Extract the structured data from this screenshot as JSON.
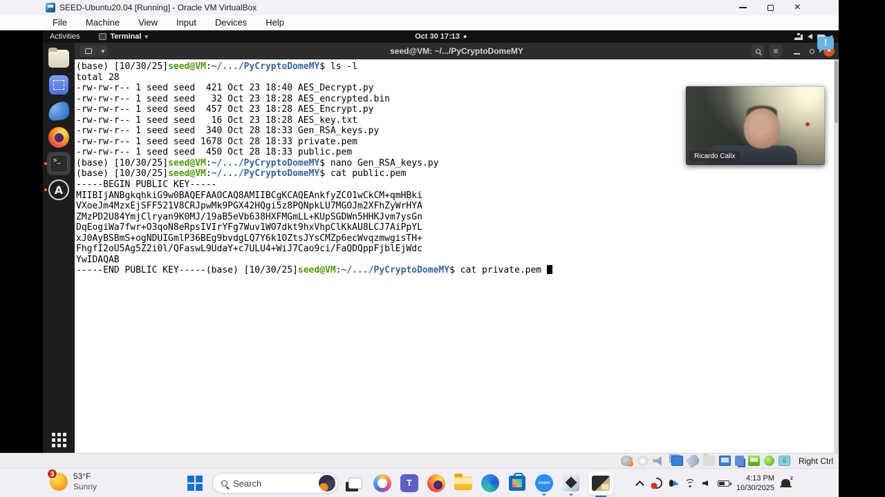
{
  "window": {
    "title": "SEED-Ubuntu20.04 [Running] - Oracle VM VirtualBox",
    "menus": [
      "File",
      "Machine",
      "View",
      "Input",
      "Devices",
      "Help"
    ]
  },
  "ubuntu_top_bar": {
    "activities": "Activities",
    "focused_app": "Terminal",
    "clock": "Oct 30 17:13"
  },
  "dock": {
    "items": [
      {
        "name": "files"
      },
      {
        "name": "screenshot-tool"
      },
      {
        "name": "wireshark"
      },
      {
        "name": "firefox"
      },
      {
        "name": "terminal",
        "running": true,
        "active": true
      },
      {
        "name": "anaconda-navigator",
        "running": true
      }
    ]
  },
  "terminal": {
    "title": "seed@VM: ~/.../PyCryptoDomeMY",
    "colors": {
      "prompt_user": "#4e9a06",
      "prompt_path": "#3465a4",
      "fg": "#000000",
      "bg": "#ffffff"
    },
    "lines": [
      {
        "seg": [
          {
            "t": "(base) [10/30/25]",
            "c": ""
          },
          {
            "t": "seed@VM",
            "c": "u"
          },
          {
            "t": ":",
            "c": ""
          },
          {
            "t": "~/.../PyCryptoDomeMY",
            "c": "p"
          },
          {
            "t": "$ ls -l",
            "c": ""
          }
        ]
      },
      {
        "seg": [
          {
            "t": "total 28",
            "c": ""
          }
        ]
      },
      {
        "seg": [
          {
            "t": "-rw-rw-r-- 1 seed seed  421 Oct 23 18:40 AES_Decrypt.py",
            "c": ""
          }
        ]
      },
      {
        "seg": [
          {
            "t": "-rw-rw-r-- 1 seed seed   32 Oct 23 18:28 AES_encrypted.bin",
            "c": ""
          }
        ]
      },
      {
        "seg": [
          {
            "t": "-rw-rw-r-- 1 seed seed  457 Oct 23 18:28 AES_Encrypt.py",
            "c": ""
          }
        ]
      },
      {
        "seg": [
          {
            "t": "-rw-rw-r-- 1 seed seed   16 Oct 23 18:28 AES_key.txt",
            "c": ""
          }
        ]
      },
      {
        "seg": [
          {
            "t": "-rw-rw-r-- 1 seed seed  340 Oct 28 18:33 Gen_RSA_keys.py",
            "c": ""
          }
        ]
      },
      {
        "seg": [
          {
            "t": "-rw-rw-r-- 1 seed seed 1678 Oct 28 18:33 private.pem",
            "c": ""
          }
        ]
      },
      {
        "seg": [
          {
            "t": "-rw-rw-r-- 1 seed seed  450 Oct 28 18:33 public.pem",
            "c": ""
          }
        ]
      },
      {
        "seg": [
          {
            "t": "(base) [10/30/25]",
            "c": ""
          },
          {
            "t": "seed@VM",
            "c": "u"
          },
          {
            "t": ":",
            "c": ""
          },
          {
            "t": "~/.../PyCryptoDomeMY",
            "c": "p"
          },
          {
            "t": "$ nano Gen_RSA_keys.py",
            "c": ""
          }
        ]
      },
      {
        "seg": [
          {
            "t": "(base) [10/30/25]",
            "c": ""
          },
          {
            "t": "seed@VM",
            "c": "u"
          },
          {
            "t": ":",
            "c": ""
          },
          {
            "t": "~/.../PyCryptoDomeMY",
            "c": "p"
          },
          {
            "t": "$ cat public.pem",
            "c": ""
          }
        ]
      },
      {
        "seg": [
          {
            "t": "-----BEGIN PUBLIC KEY-----",
            "c": ""
          }
        ]
      },
      {
        "seg": [
          {
            "t": "MIIBIjANBgkqhkiG9w0BAQEFAAOCAQ8AMIIBCgKCAQEAnkfyZCO1wCkCM+qmHBki",
            "c": ""
          }
        ]
      },
      {
        "seg": [
          {
            "t": "VXoeJm4MzxEjSFF521V8CRJpwMk9PGX42HQgi5z8PQNpkLU7MGOJm2XFhZyWrHYA",
            "c": ""
          }
        ]
      },
      {
        "seg": [
          {
            "t": "ZMzPD2U84YmjClryan9K0MJ/19aB5eVb638HXFMGmLL+KUpSGDWn5HHKJvm7ysGn",
            "c": ""
          }
        ]
      },
      {
        "seg": [
          {
            "t": "DqEogiWa7fwr+O3qoN8eRpsIVIrYFg7Wuv1WO7dkt9hxVhpClKkAU8LCJ7AiPpYL",
            "c": ""
          }
        ]
      },
      {
        "seg": [
          {
            "t": "xJ0AyBSBmS+ogNDUIGmlP36BEg9bvdgLQ7Y6k1OZtsJYsCMZp6ecWvqzmwgisTH+",
            "c": ""
          }
        ]
      },
      {
        "seg": [
          {
            "t": "FhgfI2oU5Ag5Z2i0l/QFaswL9UdaY+c7ULU4+WiJ7Cao9ci/FaQDQppFjblEjWdc",
            "c": ""
          }
        ]
      },
      {
        "seg": [
          {
            "t": "YwIDAQAB",
            "c": ""
          }
        ]
      },
      {
        "seg": [
          {
            "t": "-----END PUBLIC KEY-----",
            "c": ""
          },
          {
            "t": "(base) [10/30/25]",
            "c": ""
          },
          {
            "t": "seed@VM",
            "c": "u"
          },
          {
            "t": ":",
            "c": ""
          },
          {
            "t": "~/.../PyCryptoDomeMY",
            "c": "p"
          },
          {
            "t": "$ cat private.pem ",
            "c": ""
          }
        ],
        "cursor": true
      }
    ]
  },
  "notification": {
    "glyph": "!"
  },
  "webcam": {
    "label": "Ricardo Calix"
  },
  "vbox_status": {
    "icons": [
      "hard-disk",
      "optical-disk",
      "audio",
      "displays",
      "usb",
      "shared-folder",
      "display",
      "clipboard",
      "network",
      "mouse-integration",
      "auto-resize"
    ],
    "resize_glyph": "⇩",
    "host_key": "Right Ctrl"
  },
  "taskbar": {
    "weather": {
      "badge": "3",
      "temp": "53°F",
      "condition": "Sunny"
    },
    "search": {
      "placeholder": "Search"
    },
    "apps": [
      {
        "name": "task-view"
      },
      {
        "name": "copilot"
      },
      {
        "name": "teams",
        "glyph": "T"
      },
      {
        "name": "firefox"
      },
      {
        "name": "file-explorer"
      },
      {
        "name": "edge"
      },
      {
        "name": "microsoft-store"
      },
      {
        "name": "zoom",
        "label": "zoom",
        "running": true
      },
      {
        "name": "virtualbox",
        "running": true
      },
      {
        "name": "vm-window",
        "active": true
      }
    ],
    "teams_glyph": "T",
    "zoom_label": "zoom",
    "tray": {
      "time": "4:13 PM",
      "date": "10/30/2025"
    }
  }
}
